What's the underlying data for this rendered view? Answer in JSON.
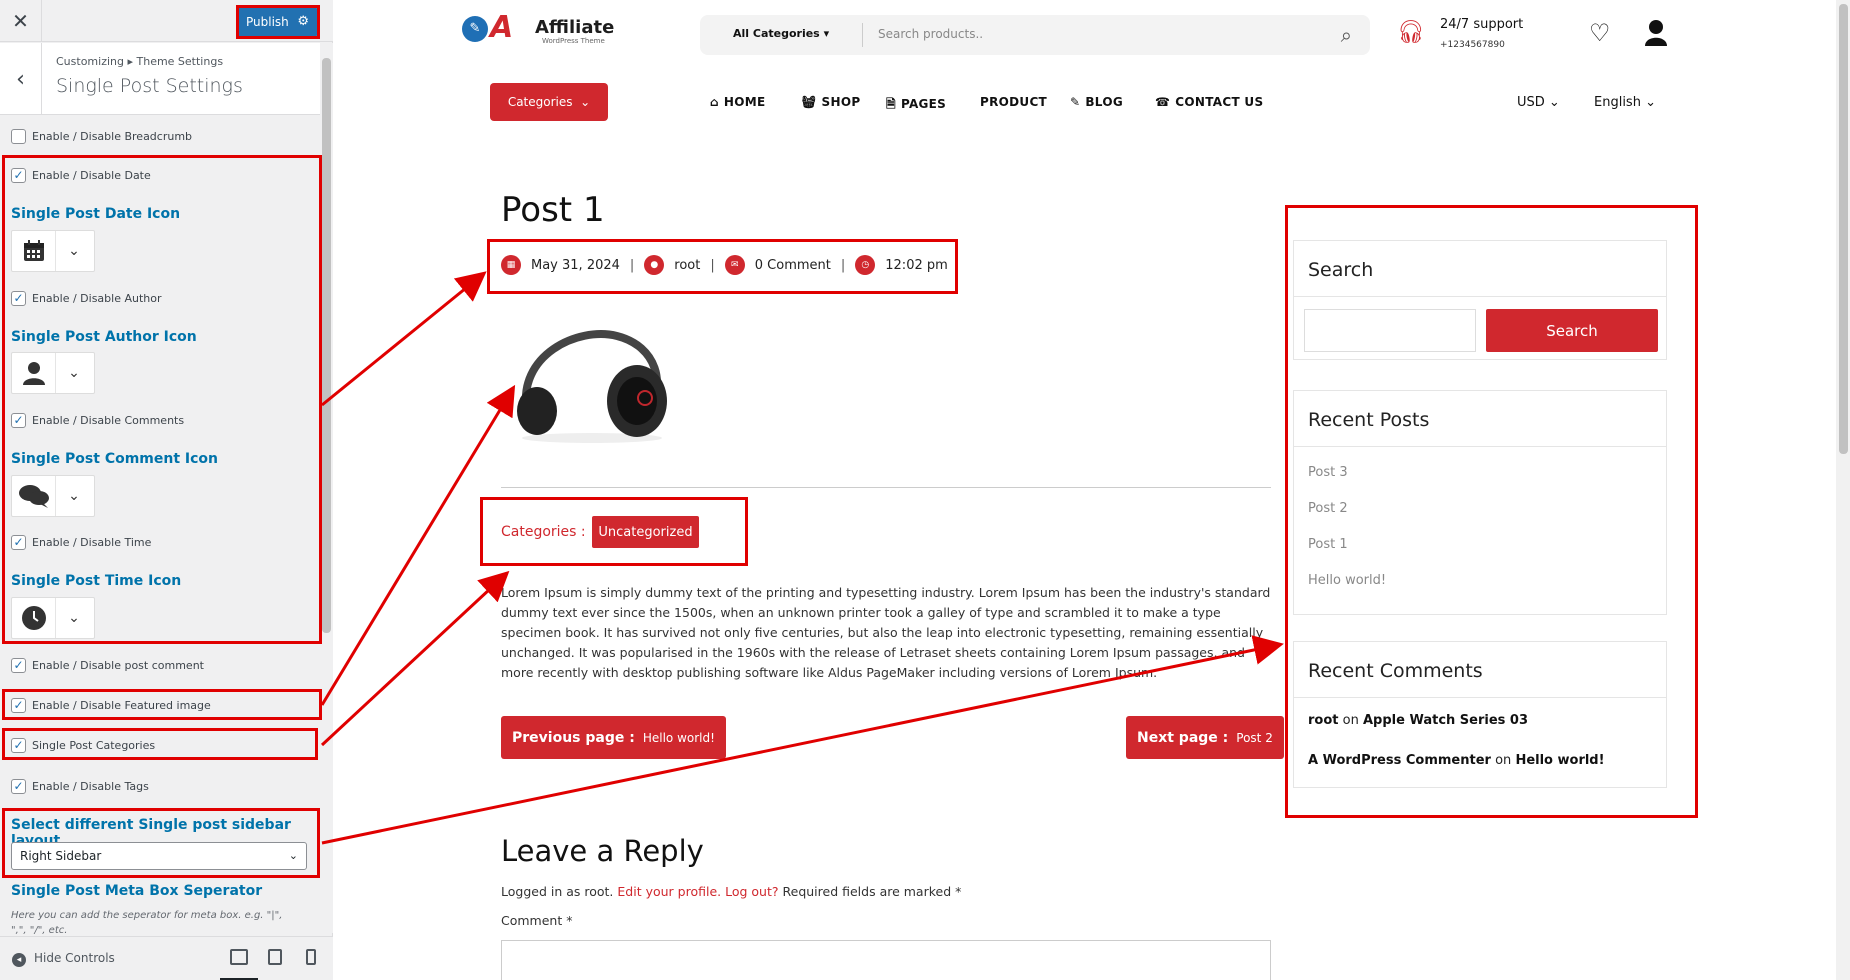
{
  "customizer": {
    "close_icon": "close-icon",
    "publish_label": "Publish",
    "breadcrumb": "Customizing ▸ Theme Settings",
    "section_title": "Single Post Settings",
    "controls": {
      "breadcrumb_toggle": "Enable / Disable Breadcrumb",
      "date_toggle": "Enable / Disable Date",
      "date_icon_title": "Single Post Date Icon",
      "author_toggle": "Enable / Disable Author",
      "author_icon_title": "Single Post Author Icon",
      "comments_toggle": "Enable / Disable Comments",
      "comment_icon_title": "Single Post Comment Icon",
      "time_toggle": "Enable / Disable Time",
      "time_icon_title": "Single Post Time Icon",
      "post_comment_toggle": "Enable / Disable post comment",
      "featured_image_toggle": "Enable / Disable Featured image",
      "categories_toggle": "Single Post Categories",
      "tags_toggle": "Enable / Disable Tags",
      "sidebar_layout_title": "Select different Single post sidebar layout",
      "sidebar_layout_value": "Right Sidebar",
      "separator_title": "Single Post Meta Box Seperator",
      "separator_desc": "Here you can add the seperator for meta box. e.g. \"|\", \",\", \"/\", etc."
    },
    "footer": {
      "hide_controls": "Hide Controls"
    }
  },
  "site": {
    "logo_name": "Affiliate",
    "logo_sub": "WordPress Theme",
    "all_categories": "All Categories",
    "search_placeholder": "Search products..",
    "support_title": "24/7 support",
    "support_phone": "+1234567890",
    "categories_button": "Categories",
    "nav": [
      "HOME",
      "SHOP",
      "PAGES",
      "PRODUCT",
      "BLOG",
      "CONTACT US"
    ],
    "currency": "USD",
    "language": "English"
  },
  "post": {
    "title": "Post 1",
    "meta": {
      "date": "May 31, 2024",
      "author": "root",
      "comments": "0 Comment",
      "time": "12:02 pm",
      "sep": "|"
    },
    "categories_label": "Categories :",
    "category": "Uncategorized",
    "body": "Lorem Ipsum is simply dummy text of the printing and typesetting industry. Lorem Ipsum has been the industry's standard dummy text ever since the 1500s, when an unknown printer took a galley of type and scrambled it to make a type specimen book. It has survived not only five centuries, but also the leap into electronic typesetting, remaining essentially unchanged. It was popularised in the 1960s with the release of Letraset sheets containing Lorem Ipsum passages, and more recently with desktop publishing software like Aldus PageMaker including versions of Lorem Ipsum.",
    "prev_label": "Previous page :",
    "prev_title": "Hello world!",
    "next_label": "Next page :",
    "next_title": "Post 2"
  },
  "reply": {
    "title": "Leave a Reply",
    "logged_in_prefix": "Logged in as root.",
    "edit_profile": "Edit your profile.",
    "log_out": "Log out?",
    "required": "Required fields are marked *",
    "comment_label": "Comment *"
  },
  "sidebar": {
    "search_title": "Search",
    "search_button": "Search",
    "recent_posts_title": "Recent Posts",
    "recent_posts": [
      "Post 3",
      "Post 2",
      "Post 1",
      "Hello world!"
    ],
    "recent_comments_title": "Recent Comments",
    "recent_comments": [
      {
        "author": "root",
        "on": "on",
        "post": "Apple Watch Series 03"
      },
      {
        "author": "A WordPress Commenter",
        "on": "on",
        "post": "Hello world!"
      }
    ]
  },
  "colors": {
    "accent": "#d0282e",
    "wp_blue": "#2271b1",
    "annotation": "#e00000"
  }
}
